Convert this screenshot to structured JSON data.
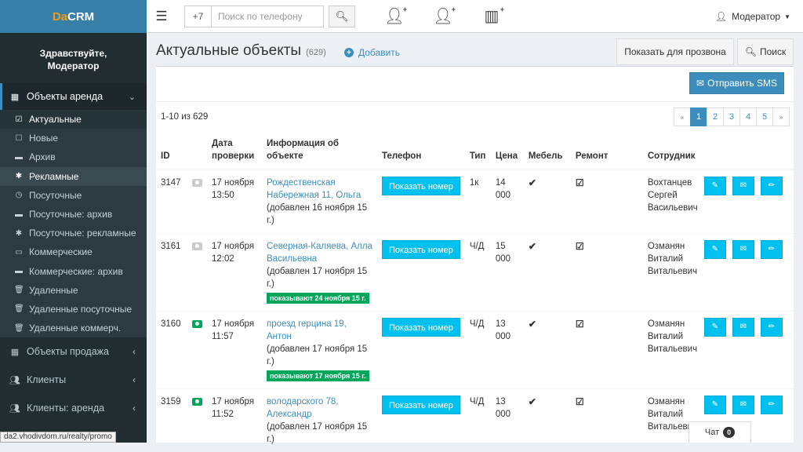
{
  "app": {
    "logo_prefix": "Da",
    "logo_suffix": "CRM",
    "greeting_line1": "Здравствуйте,",
    "greeting_line2": "Модератор"
  },
  "sidebar": {
    "section_active": "Объекты аренда",
    "sub_items": [
      {
        "label": "Актуальные",
        "icon": "check-square-icon"
      },
      {
        "label": "Новые",
        "icon": "square-icon"
      },
      {
        "label": "Архив",
        "icon": "archive-icon"
      },
      {
        "label": "Рекламные",
        "icon": "asterisk-icon"
      },
      {
        "label": "Посуточные",
        "icon": "clock-icon"
      },
      {
        "label": "Посуточные: архив",
        "icon": "archive-icon"
      },
      {
        "label": "Посуточные: рекламные",
        "icon": "asterisk-icon"
      },
      {
        "label": "Коммерческие",
        "icon": "money-icon"
      },
      {
        "label": "Коммерческие: архив",
        "icon": "archive-icon"
      },
      {
        "label": "Удаленные",
        "icon": "trash-icon"
      },
      {
        "label": "Удаленные посуточные",
        "icon": "trash-icon"
      },
      {
        "label": "Удаленные коммерч.",
        "icon": "trash-icon"
      }
    ],
    "groups": [
      {
        "label": "Объекты продажа",
        "icon": "building-icon"
      },
      {
        "label": "Клиенты",
        "icon": "users-icon"
      },
      {
        "label": "Клиенты: аренда",
        "icon": "users-icon"
      }
    ]
  },
  "topbar": {
    "phone_prefix": "+7",
    "phone_placeholder": "Поиск по телефону",
    "user_name": "Модератор"
  },
  "header": {
    "title": "Актуальные объекты",
    "count": "(629)",
    "add_label": "Добавить",
    "call_button": "Показать для прозвона",
    "search_button": "Поиск"
  },
  "box": {
    "sms_button": "Отправить SMS",
    "range_text": "1-10 из 629",
    "pager": {
      "prev": "«",
      "next": "»",
      "pages": [
        "1",
        "2",
        "3",
        "4",
        "5"
      ],
      "current": "1"
    }
  },
  "table": {
    "headers": {
      "id": "ID",
      "date": "Дата проверки",
      "info": "Информация об объекте",
      "phone": "Телефон",
      "type": "Тип",
      "price": "Цена",
      "furniture": "Мебель",
      "repair": "Ремонт",
      "employee": "Сотрудник"
    },
    "show_number_label": "Показать номер",
    "rows": [
      {
        "id": "3147",
        "photo": "none",
        "date": "17 ноября",
        "time": "13:50",
        "address": "Рождественская Набережная 11, Ольга",
        "added": "(добавлен 16 ноября 15 г.)",
        "badge": "",
        "type": "1к",
        "price": "14 000",
        "employee": "Вохтанцев Сергей Васильевич"
      },
      {
        "id": "3161",
        "photo": "none",
        "date": "17 ноября",
        "time": "12:02",
        "address": "Северная-Каляева, Алла Васильевна",
        "added": "(добавлен 17 ноября 15 г.)",
        "badge": "показывают 24 ноября 15 г.",
        "type": "Ч/Д",
        "price": "15 000",
        "employee": "Озманян Виталий Витальевич"
      },
      {
        "id": "3160",
        "photo": "yes",
        "date": "17 ноября",
        "time": "11:57",
        "address": "проезд герцина 19, Антон",
        "added": "(добавлен 17 ноября 15 г.)",
        "badge": "показывают 17 ноября 15 г.",
        "type": "Ч/Д",
        "price": "13 000",
        "employee": "Озманян Виталий Витальевич"
      },
      {
        "id": "3159",
        "photo": "yes",
        "date": "17 ноября",
        "time": "11:52",
        "address": "володарского 78, Александр",
        "added": "(добавлен 17 ноября 15 г.)",
        "badge": "",
        "type": "Ч/Д",
        "price": "13 000",
        "employee": "Озманян Виталий Витальевич"
      }
    ]
  },
  "status_url": "da2.vhodivdom.ru/realty/promo",
  "chat": {
    "label": "Чат",
    "count": "0"
  }
}
